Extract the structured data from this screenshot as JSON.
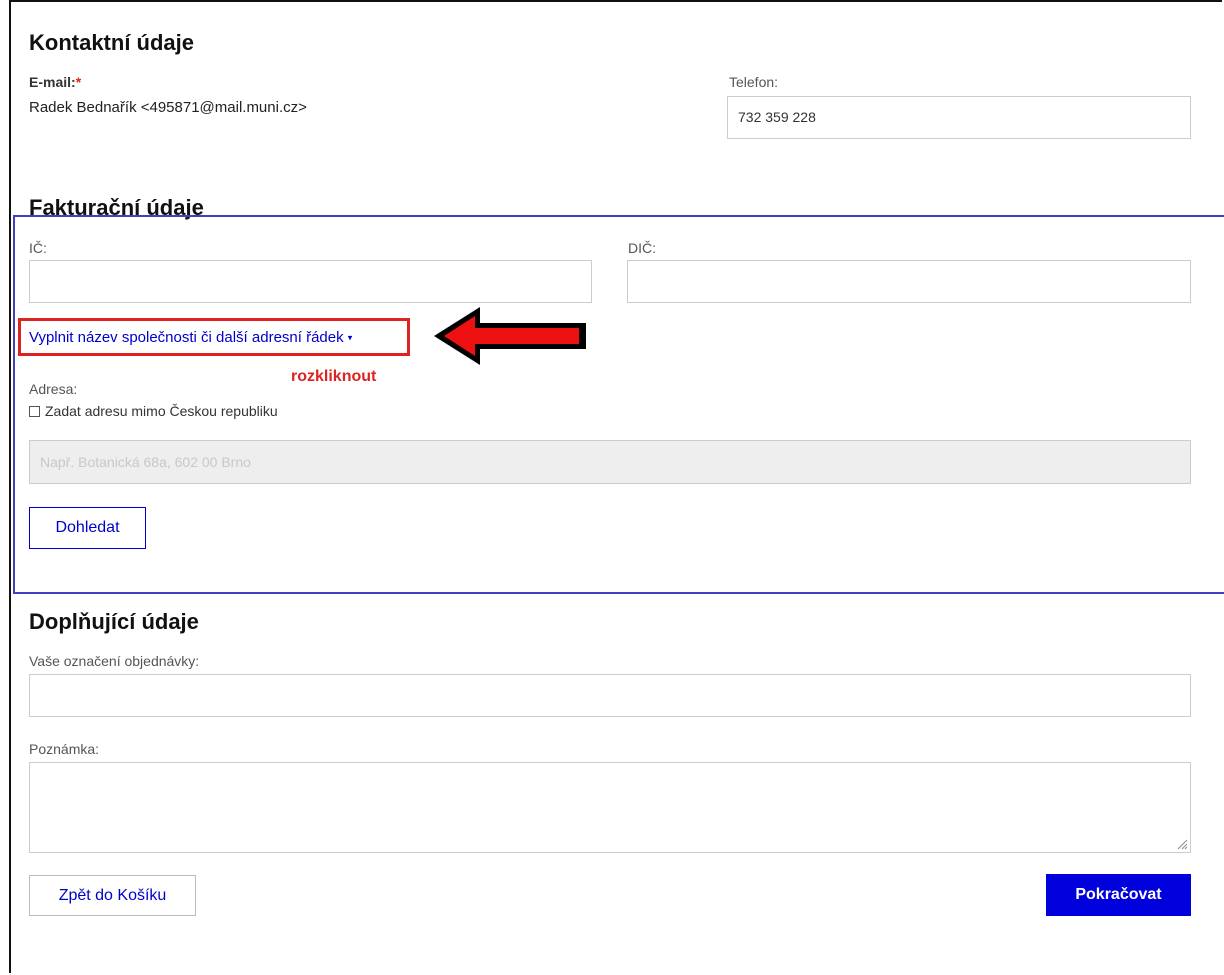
{
  "contact": {
    "title": "Kontaktní údaje",
    "email_label": "E-mail:",
    "required_mark": "*",
    "email_value": "Radek Bednařík <495871@mail.muni.cz>",
    "phone_label": "Telefon:",
    "phone_value": "732 359 228"
  },
  "billing": {
    "title": "Fakturační údaje",
    "ic_label": "IČ:",
    "dic_label": "DIČ:",
    "company_link": "Vyplnit název společnosti či další adresní řádek",
    "annotation_text": "rozkliknout",
    "address_label": "Adresa:",
    "foreign_address_label": "Zadat adresu mimo Českou republiku",
    "address_placeholder": "Např. Botanická 68a, 602 00 Brno",
    "lookup_button": "Dohledat"
  },
  "additional": {
    "title": "Doplňující údaje",
    "order_ref_label": "Vaše označení objednávky:",
    "note_label": "Poznámka:"
  },
  "actions": {
    "back_button": "Zpět do Košíku",
    "continue_button": "Pokračovat"
  },
  "colors": {
    "link": "#0000cc",
    "primary": "#0000dc",
    "annotation": "#dd2222",
    "highlight_box": "#4040c0"
  }
}
